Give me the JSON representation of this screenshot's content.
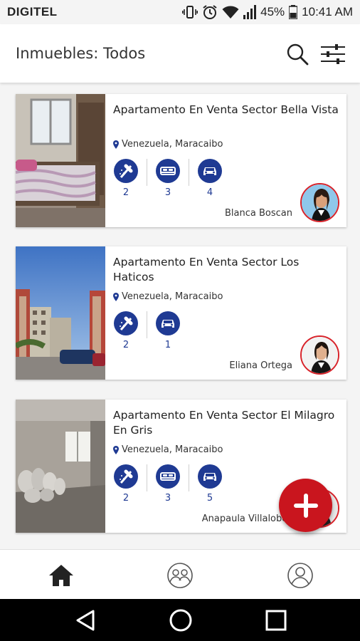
{
  "status_bar": {
    "carrier": "DIGITEL",
    "battery": "45%",
    "time": "10:41 AM",
    "icons": [
      "vibrate-icon",
      "alarm-icon",
      "wifi-icon",
      "signal-icon",
      "battery-icon"
    ]
  },
  "header": {
    "title": "Inmuebles: Todos",
    "icons": [
      "search-icon",
      "filter-sliders-icon"
    ]
  },
  "listings": [
    {
      "title": "Apartamento En Venta Sector Bella Vista",
      "location": "Venezuela, Maracaibo",
      "features": [
        {
          "icon": "bathroom-shower-icon",
          "count": "2"
        },
        {
          "icon": "bed-icon",
          "count": "3"
        },
        {
          "icon": "car-icon",
          "count": "4"
        }
      ],
      "agent": "Blanca Boscan",
      "photo": "bedroom-photo"
    },
    {
      "title": "Apartamento En Venta Sector Los Haticos",
      "location": "Venezuela, Maracaibo",
      "features": [
        {
          "icon": "bathroom-shower-icon",
          "count": "2"
        },
        {
          "icon": "car-icon",
          "count": "1"
        }
      ],
      "agent": "Eliana Ortega",
      "photo": "building-exterior-photo"
    },
    {
      "title": "Apartamento En Venta Sector El Milagro En Gris",
      "location": "Venezuela, Maracaibo",
      "features": [
        {
          "icon": "bathroom-shower-icon",
          "count": "2"
        },
        {
          "icon": "bed-icon",
          "count": "3"
        },
        {
          "icon": "car-icon",
          "count": "5"
        }
      ],
      "agent": "Anapaula Villalobos",
      "photo": "unfinished-interior-photo"
    }
  ],
  "fab": {
    "icon": "plus-icon"
  },
  "bottom_nav": [
    {
      "name": "home",
      "icon": "home-icon"
    },
    {
      "name": "agents",
      "icon": "agents-icon"
    },
    {
      "name": "profile",
      "icon": "profile-icon"
    }
  ],
  "system_nav": [
    "back-icon",
    "home-circle-icon",
    "recent-apps-icon"
  ],
  "colors": {
    "accent_blue": "#1f3a93",
    "fab_red": "#c9151e",
    "avatar_border": "#d8232a"
  }
}
